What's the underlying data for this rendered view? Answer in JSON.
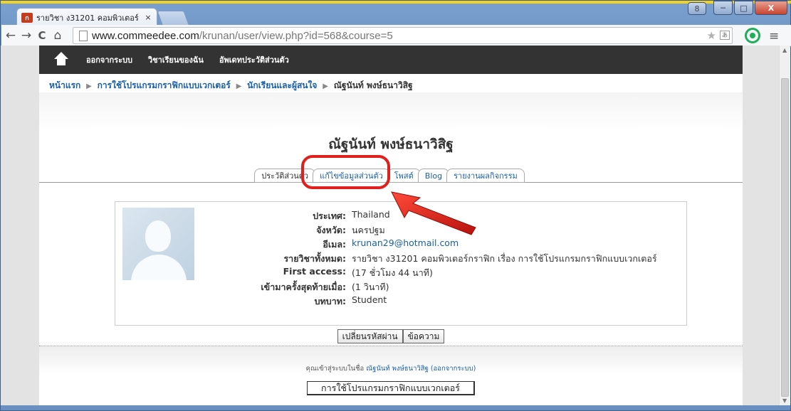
{
  "browser": {
    "tab_favicon": "ก",
    "tab_title": "รายวิชา ง31201 คอมพิวเตอร์",
    "tab_close": "×",
    "url_host": "www.commeedee.com",
    "url_path": "/krunan/user/view.php?id=568&course=5",
    "back_icon": "←",
    "forward_icon": "→",
    "reload_icon": "C",
    "home_icon": "⌂",
    "star_icon": "★",
    "menu_icon": "≡",
    "win_user": "8",
    "win_min": "─",
    "win_max": "□",
    "win_close": "X"
  },
  "topnav": {
    "items": [
      "ออกจากระบบ",
      "วิชาเรียนของฉัน",
      "อัพเดทประวัติส่วนตัว"
    ]
  },
  "breadcrumb": {
    "items": [
      "หน้าแรก",
      "การใช้โปรแกรมกราฟิกแบบเวกเตอร์",
      "นักเรียนและผู้สนใจ"
    ],
    "current": "ณัฐนันท์ พงษ์ธนาวิสิฐ",
    "separator": "▶"
  },
  "profile": {
    "name": "ณัฐนันท์ พงษ์ธนาวิสิฐ",
    "tabs": [
      {
        "label": "ประวัติส่วนตัว",
        "active": true
      },
      {
        "label": "แก้ไขข้อมูลส่วนตัว",
        "active": false
      },
      {
        "label": "โพสต์",
        "active": false
      },
      {
        "label": "Blog",
        "active": false
      },
      {
        "label": "รายงานผลกิจกรรม",
        "active": false
      }
    ],
    "fields": [
      {
        "label": "ประเทศ:",
        "value": "Thailand"
      },
      {
        "label": "จังหวัด:",
        "value": "นครปฐม"
      },
      {
        "label": "อีเมล:",
        "value": "krunan29@hotmail.com"
      },
      {
        "label": "รายวิชาทั้งหมด:",
        "value": "รายวิชา ง31201 คอมพิวเตอร์กราฟิก เรื่อง การใช้โปรแกรมกราฟิกแบบเวกเตอร์"
      },
      {
        "label": "First access:",
        "value": "(17 ชั่วโมง 44 นาที)"
      },
      {
        "label": "เข้ามาครั้งสุดท้ายเมื่อ:",
        "value": "(1 วินาที)"
      },
      {
        "label": "บทบาท:",
        "value": "Student"
      }
    ],
    "buttons": {
      "change_password": "เปลี่ยนรหัสผ่าน",
      "message": "ข้อความ"
    }
  },
  "footer": {
    "login_prefix": "คุณเข้าสู่ระบบในชื่อ",
    "login_name": "ณัฐนันท์ พงษ์ธนาวิสิฐ",
    "logout_link": "(ออกจากระบบ)",
    "course_button": "การใช้โปรแกรมกราฟิกแบบเวกเตอร์"
  },
  "colors": {
    "annotation_red": "#e0201c",
    "link_blue": "#1a5fa8",
    "nav_bar": "#333333"
  }
}
